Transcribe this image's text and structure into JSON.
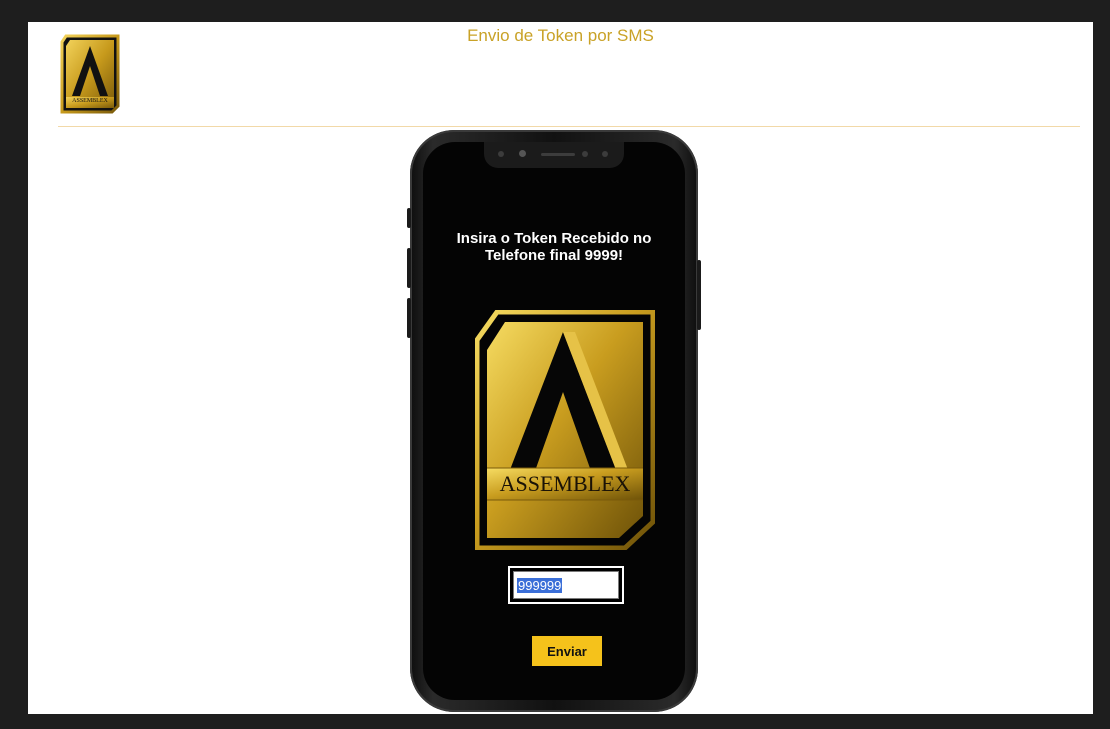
{
  "header": {
    "title": "Envio de Token por SMS",
    "logo_text": "ASSEMBLEX"
  },
  "phone": {
    "instruction": "Insira o Token Recebido no Telefone final 9999!",
    "logo_text": "ASSEMBLEX",
    "token_value": "999999",
    "send_label": "Enviar"
  },
  "colors": {
    "gold": "#c9a227",
    "button": "#f5c21b",
    "selection": "#3b6fd8"
  },
  "icons": [
    "assemblex-logo"
  ]
}
